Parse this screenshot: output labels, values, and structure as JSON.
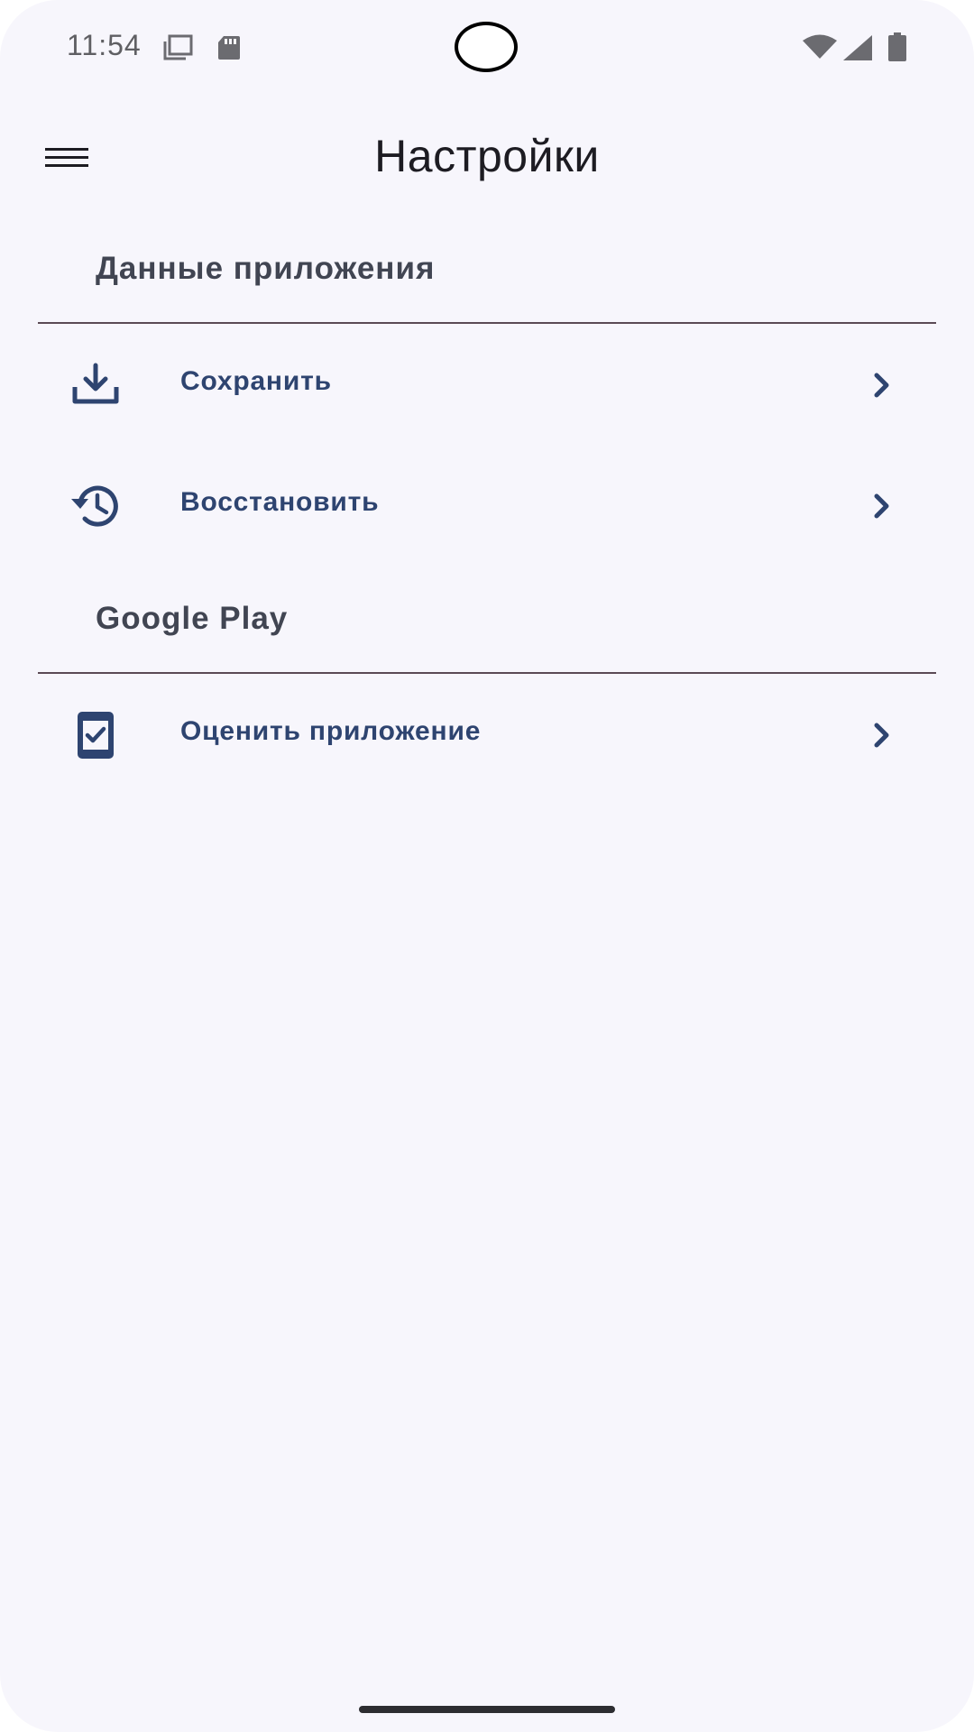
{
  "status_bar": {
    "time": "11:54",
    "left_icons": [
      "screenshot-icon",
      "sd-card-icon"
    ],
    "right_icons": [
      "wifi-icon",
      "signal-icon",
      "battery-icon"
    ]
  },
  "app_bar": {
    "title": "Настройки",
    "menu_icon": "hamburger-menu-icon"
  },
  "sections": [
    {
      "header": "Данные приложения",
      "items": [
        {
          "label": "Сохранить",
          "icon": "download-icon"
        },
        {
          "label": "Восстановить",
          "icon": "history-icon"
        }
      ]
    },
    {
      "header": "Google Play",
      "items": [
        {
          "label": "Оценить приложение",
          "icon": "rate-app-icon"
        }
      ]
    }
  ],
  "colors": {
    "background": "#f7f6fc",
    "accent": "#2e4470",
    "header_text": "#414552",
    "divider": "#5b4a55",
    "title_text": "#1d1c22"
  }
}
